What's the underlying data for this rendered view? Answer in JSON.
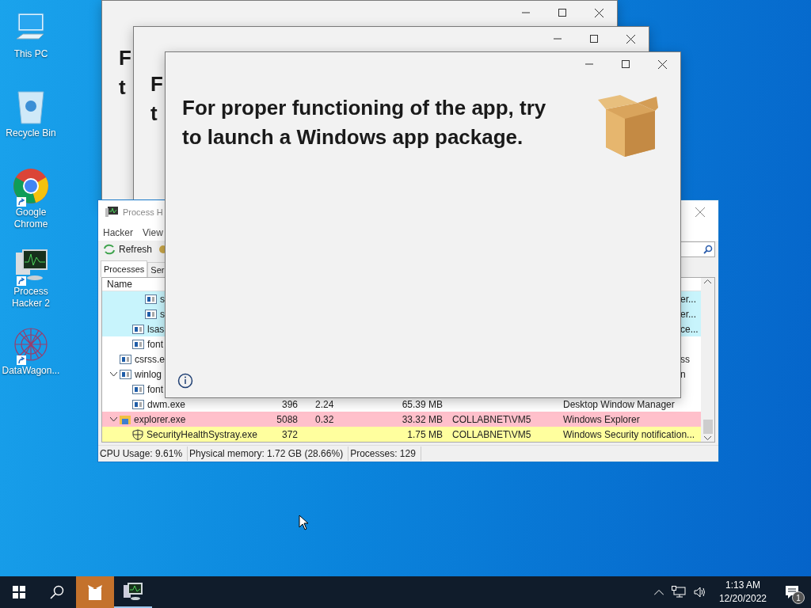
{
  "desktop_icons": [
    {
      "label": "This PC",
      "kind": "pc",
      "shortcut": false
    },
    {
      "label": "Recycle Bin",
      "kind": "bin",
      "shortcut": false
    },
    {
      "label": "Google Chrome",
      "kind": "chrome",
      "shortcut": true
    },
    {
      "label": "Process Hacker 2",
      "kind": "monitor",
      "shortcut": true
    },
    {
      "label": "DataWagon...",
      "kind": "mesh",
      "shortcut": true
    }
  ],
  "back_dialogs": [
    {
      "lines": [
        "F",
        "t"
      ]
    },
    {
      "lines": [
        "F",
        "t"
      ]
    }
  ],
  "process_hacker": {
    "title": "Process H",
    "menu": [
      "Hacker",
      "View"
    ],
    "toolbar": [
      "Refresh"
    ],
    "tabs": [
      {
        "label": "Processes",
        "selected": true
      },
      {
        "label": "Ser",
        "selected": false
      }
    ],
    "columns": [
      "Name"
    ],
    "tree": [
      {
        "children": [
          {
            "children": [
              {
                "kind": "partial",
                "name": "s",
                "description": "er...",
                "color": "#c8f4fc"
              },
              {
                "kind": "partial",
                "name": "s",
                "description": "er...",
                "color": "#c8f4fc"
              }
            ]
          },
          {
            "kind": "partial",
            "name": "lsas",
            "description": "ce...",
            "color": "#c8f4fc"
          },
          {
            "kind": "partial",
            "name": "font",
            "color": "#ffffff"
          }
        ]
      },
      {
        "kind": "partial",
        "name": "csrss.e",
        "description": "ss",
        "color": "#ffffff"
      },
      {
        "kind": "partial",
        "name": "winlog",
        "description": "n",
        "color": "#ffffff",
        "expanded": true,
        "children": [
          {
            "kind": "partial",
            "name": "font",
            "color": "#ffffff"
          },
          {
            "kind": "process",
            "name": "dwm.exe",
            "pid": "396",
            "cpu": "2.24",
            "private": "65.39 MB",
            "description": "Desktop Window Manager",
            "color": "#ffffff"
          }
        ]
      },
      {
        "kind": "folder",
        "name": "explorer.exe",
        "pid": "5088",
        "cpu": "0.32",
        "private": "33.32 MB",
        "user": "COLLABNET\\VM5",
        "description": "Windows Explorer",
        "color": "#ffc0cb",
        "expanded": true,
        "children": [
          {
            "kind": "shield",
            "name": "SecurityHealthSystray.exe",
            "pid": "372",
            "private": "1.75 MB",
            "user": "COLLABNET\\VM5",
            "description": "Windows Security notification...",
            "color": "#ffff9e"
          }
        ]
      }
    ],
    "status": [
      "CPU Usage: 9.61%",
      "Physical memory: 1.72 GB (28.66%)",
      "Processes: 129"
    ]
  },
  "dialog": {
    "message": "For proper functioning of the app, try to launch a Windows app package."
  },
  "taskbar": {
    "apps": [
      {
        "kind": "package",
        "active": true
      },
      {
        "kind": "monitor",
        "active": false
      }
    ],
    "time": "1:13 AM",
    "date": "12/20/2022",
    "notifications": "1"
  }
}
